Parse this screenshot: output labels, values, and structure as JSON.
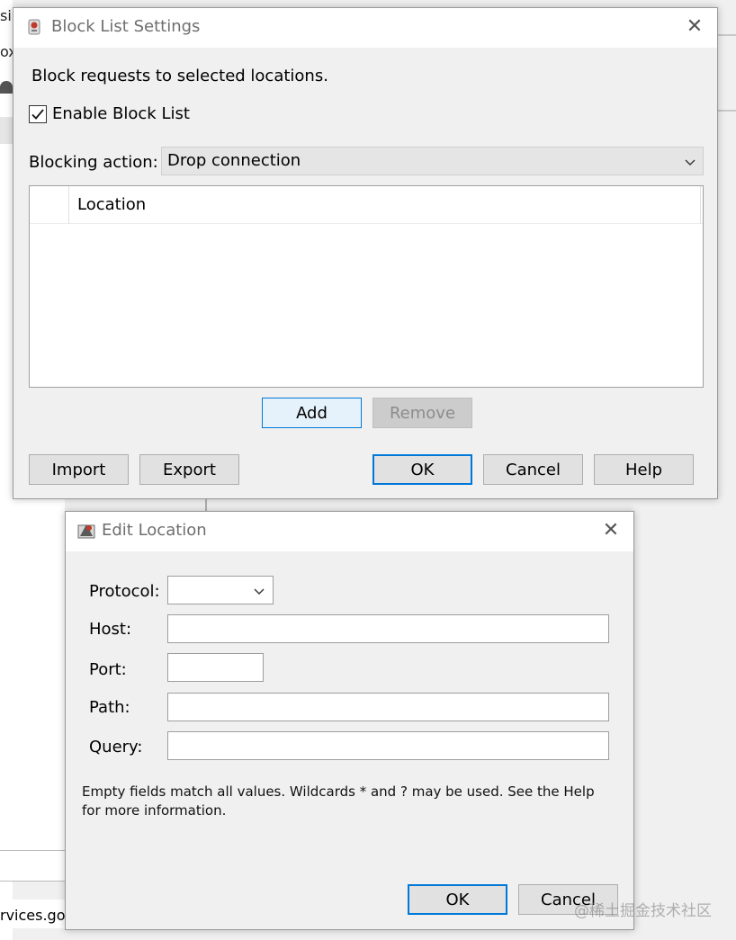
{
  "background": {
    "fragment_top": "si",
    "fragment_second": "ox",
    "status_text": "rvices.goo"
  },
  "block_list_dialog": {
    "title": "Block List Settings",
    "description": "Block requests to selected locations.",
    "enable_checkbox": {
      "label": "Enable Block List",
      "checked": true
    },
    "blocking_action": {
      "label": "Blocking action:",
      "selected": "Drop connection"
    },
    "table": {
      "columns": [
        "",
        "Location"
      ],
      "rows": []
    },
    "buttons": {
      "add": "Add",
      "remove": "Remove",
      "import": "Import",
      "export": "Export",
      "ok": "OK",
      "cancel": "Cancel",
      "help": "Help"
    }
  },
  "edit_location_dialog": {
    "title": "Edit Location",
    "fields": {
      "protocol": {
        "label": "Protocol:",
        "value": ""
      },
      "host": {
        "label": "Host:",
        "value": ""
      },
      "port": {
        "label": "Port:",
        "value": ""
      },
      "path": {
        "label": "Path:",
        "value": ""
      },
      "query": {
        "label": "Query:",
        "value": ""
      }
    },
    "info_text": "Empty fields match all values. Wildcards * and ? may be used. See the Help for more information.",
    "buttons": {
      "ok": "OK",
      "cancel": "Cancel"
    }
  },
  "watermark": "@稀土掘金技术社区",
  "colors": {
    "accent": "#0078d7",
    "dialog_bg": "#f0f0f0",
    "titlebar_bg": "#ffffff",
    "button_bg": "#e1e1e1",
    "disabled_text": "#8c8c8c"
  }
}
